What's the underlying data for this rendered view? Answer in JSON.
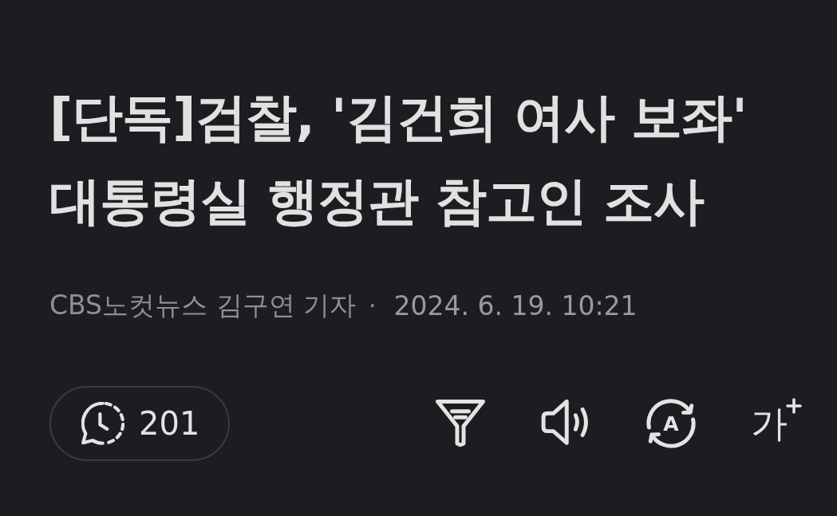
{
  "headline": {
    "lines": [
      "[단독]검찰, '김건희 여사 보좌'",
      "대통령실 행정관 참고인 조사"
    ]
  },
  "byline": {
    "source": "CBS노컷뉴스 김구연 기자",
    "separator": "·",
    "date": "2024. 6. 19. 10:21"
  },
  "toolbar": {
    "comment_count": "201",
    "actions": [
      {
        "kind": "summary"
      },
      {
        "kind": "audio"
      },
      {
        "kind": "translate",
        "glyph": "A"
      },
      {
        "kind": "font_size",
        "glyph": "가"
      }
    ]
  }
}
